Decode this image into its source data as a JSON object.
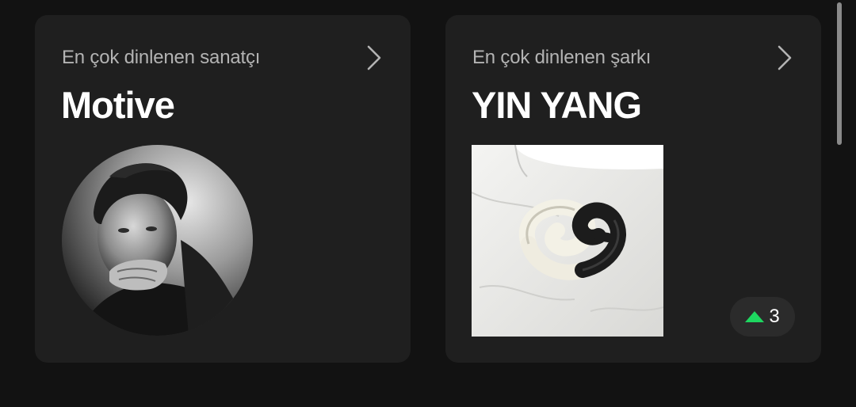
{
  "cards": [
    {
      "subtitle": "En çok dinlenen sanatçı",
      "title": "Motive",
      "image": "artist-photo"
    },
    {
      "subtitle": "En çok dinlenen şarkı",
      "title": "YIN YANG",
      "image": "album-cover",
      "rank_change": "3",
      "rank_direction": "up"
    }
  ],
  "icons": {
    "chevron": "chevron-right-icon",
    "rank": "triangle-up-icon"
  },
  "colors": {
    "background": "#121212",
    "card": "#1f1f1f",
    "subtitle": "#b3b3b3",
    "accent_green": "#1ed760"
  }
}
